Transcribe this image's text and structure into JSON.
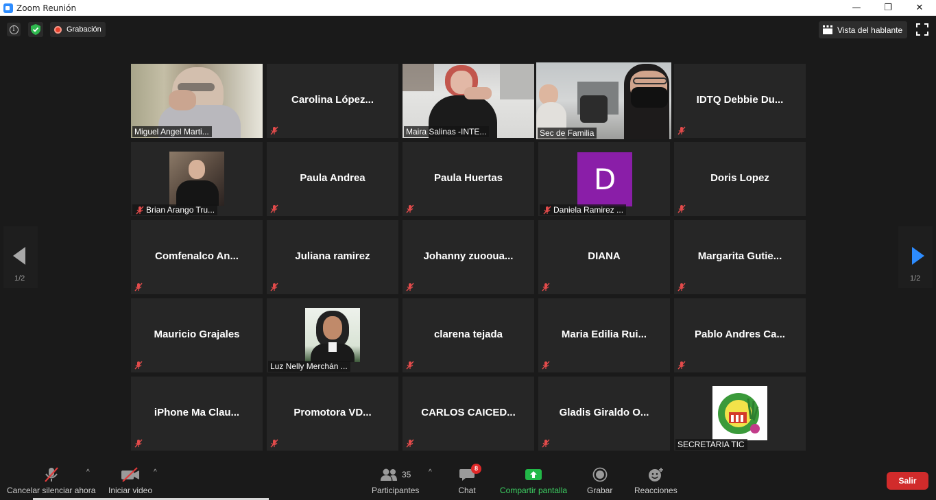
{
  "window": {
    "title": "Zoom Reunión",
    "minimize_glyph": "—",
    "restore_glyph": "❐",
    "close_glyph": "✕"
  },
  "topbar": {
    "info_icon": "info-icon",
    "shield_icon": "shield-check-icon",
    "recording_label": "Grabación",
    "view_label": "Vista del hablante",
    "fullscreen_icon": "fullscreen-icon"
  },
  "colors": {
    "active_speaker": "#d7e063",
    "avatar_purple": "#8a1ea8",
    "leave": "#d12b2b",
    "share_green": "#3dd163",
    "nav_arrow": "#2d8cff"
  },
  "participants": [
    {
      "name": "Miguel Angel Marti...",
      "video": true,
      "muted": false
    },
    {
      "name": "Carolina  López...",
      "video": false,
      "muted": true
    },
    {
      "name": "Maira Salinas -INTE...",
      "video": true,
      "muted": false
    },
    {
      "name": "Sec de Familia",
      "video": true,
      "muted": false,
      "active": true
    },
    {
      "name": "IDTQ  Debbie  Du...",
      "video": false,
      "muted": true
    },
    {
      "name": "Brian Arango Tru...",
      "photo": true,
      "muted": true
    },
    {
      "name": "Paula Andrea",
      "video": false,
      "muted": true
    },
    {
      "name": "Paula Huertas",
      "video": false,
      "muted": true
    },
    {
      "name": "Daniela Ramirez ...",
      "avatar_letter": "D",
      "muted": true
    },
    {
      "name": "Doris Lopez",
      "video": false,
      "muted": true
    },
    {
      "name": "Comfenalco  An...",
      "video": false,
      "muted": true
    },
    {
      "name": "Juliana ramirez",
      "video": false,
      "muted": true
    },
    {
      "name": "Johanny  zuooua...",
      "video": false,
      "muted": true
    },
    {
      "name": "DIANA",
      "video": false,
      "muted": true
    },
    {
      "name": "Margarita  Gutie...",
      "video": false,
      "muted": true
    },
    {
      "name": "Mauricio Grajales",
      "video": false,
      "muted": true
    },
    {
      "name": "Luz Nelly Merchán ...",
      "photo": true,
      "muted": false
    },
    {
      "name": "clarena tejada",
      "video": false,
      "muted": true
    },
    {
      "name": "Maria  Edilia  Rui...",
      "video": false,
      "muted": true
    },
    {
      "name": "Pablo Andres Ca...",
      "video": false,
      "muted": true
    },
    {
      "name": "iPhone  Ma  Clau...",
      "video": false,
      "muted": true
    },
    {
      "name": "Promotora  VD...",
      "video": false,
      "muted": true
    },
    {
      "name": "CARLOS  CAICED...",
      "video": false,
      "muted": true
    },
    {
      "name": "Gladis Giraldo O...",
      "video": false,
      "muted": true
    },
    {
      "name": "SECRETARIA TIC",
      "logo": true,
      "muted": false
    }
  ],
  "pagination": {
    "left_label": "1/2",
    "right_label": "1/2"
  },
  "toolbar": {
    "unmute_label": "Cancelar silenciar ahora",
    "video_label": "Iniciar video",
    "participants_label": "Participantes",
    "participants_count": "35",
    "chat_label": "Chat",
    "chat_badge": "8",
    "share_label": "Compartir pantalla",
    "record_label": "Grabar",
    "reactions_label": "Reacciones",
    "leave_label": "Salir",
    "caret_glyph": "^"
  }
}
